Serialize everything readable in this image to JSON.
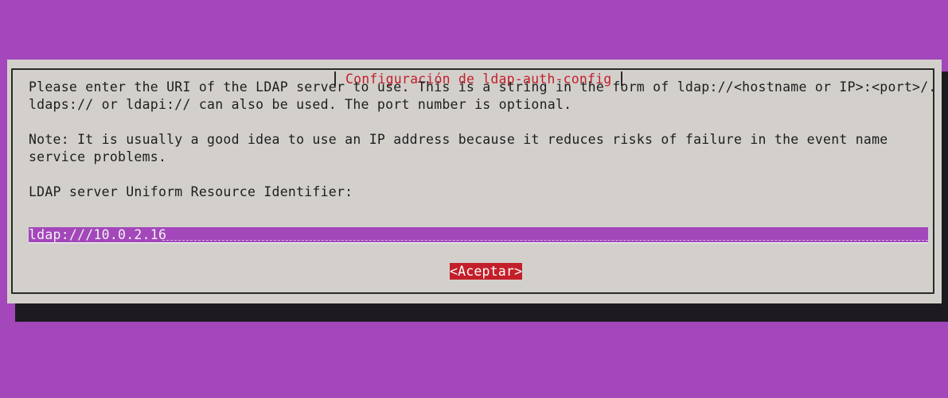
{
  "dialog": {
    "title": "Configuración de ldap-auth-config",
    "paragraph1_line1": "Please enter the URI of the LDAP server to use. This is a string in the form of ldap://<hostname or IP>:<port>/.",
    "paragraph1_line2": "ldaps:// or ldapi:// can also be used. The port number is optional.",
    "paragraph2_line1": "Note: It is usually a good idea to use an IP address because it reduces risks of failure in the event name",
    "paragraph2_line2": "service problems.",
    "field_label": "LDAP server Uniform Resource Identifier:",
    "field_value": "ldap:///10.0.2.16",
    "accept_button": "<Aceptar>"
  },
  "colors": {
    "background": "#a347ba",
    "dialog": "#d3d0cc",
    "title": "#c31f2a",
    "button": "#c31f2a",
    "field": "#a347ba"
  }
}
